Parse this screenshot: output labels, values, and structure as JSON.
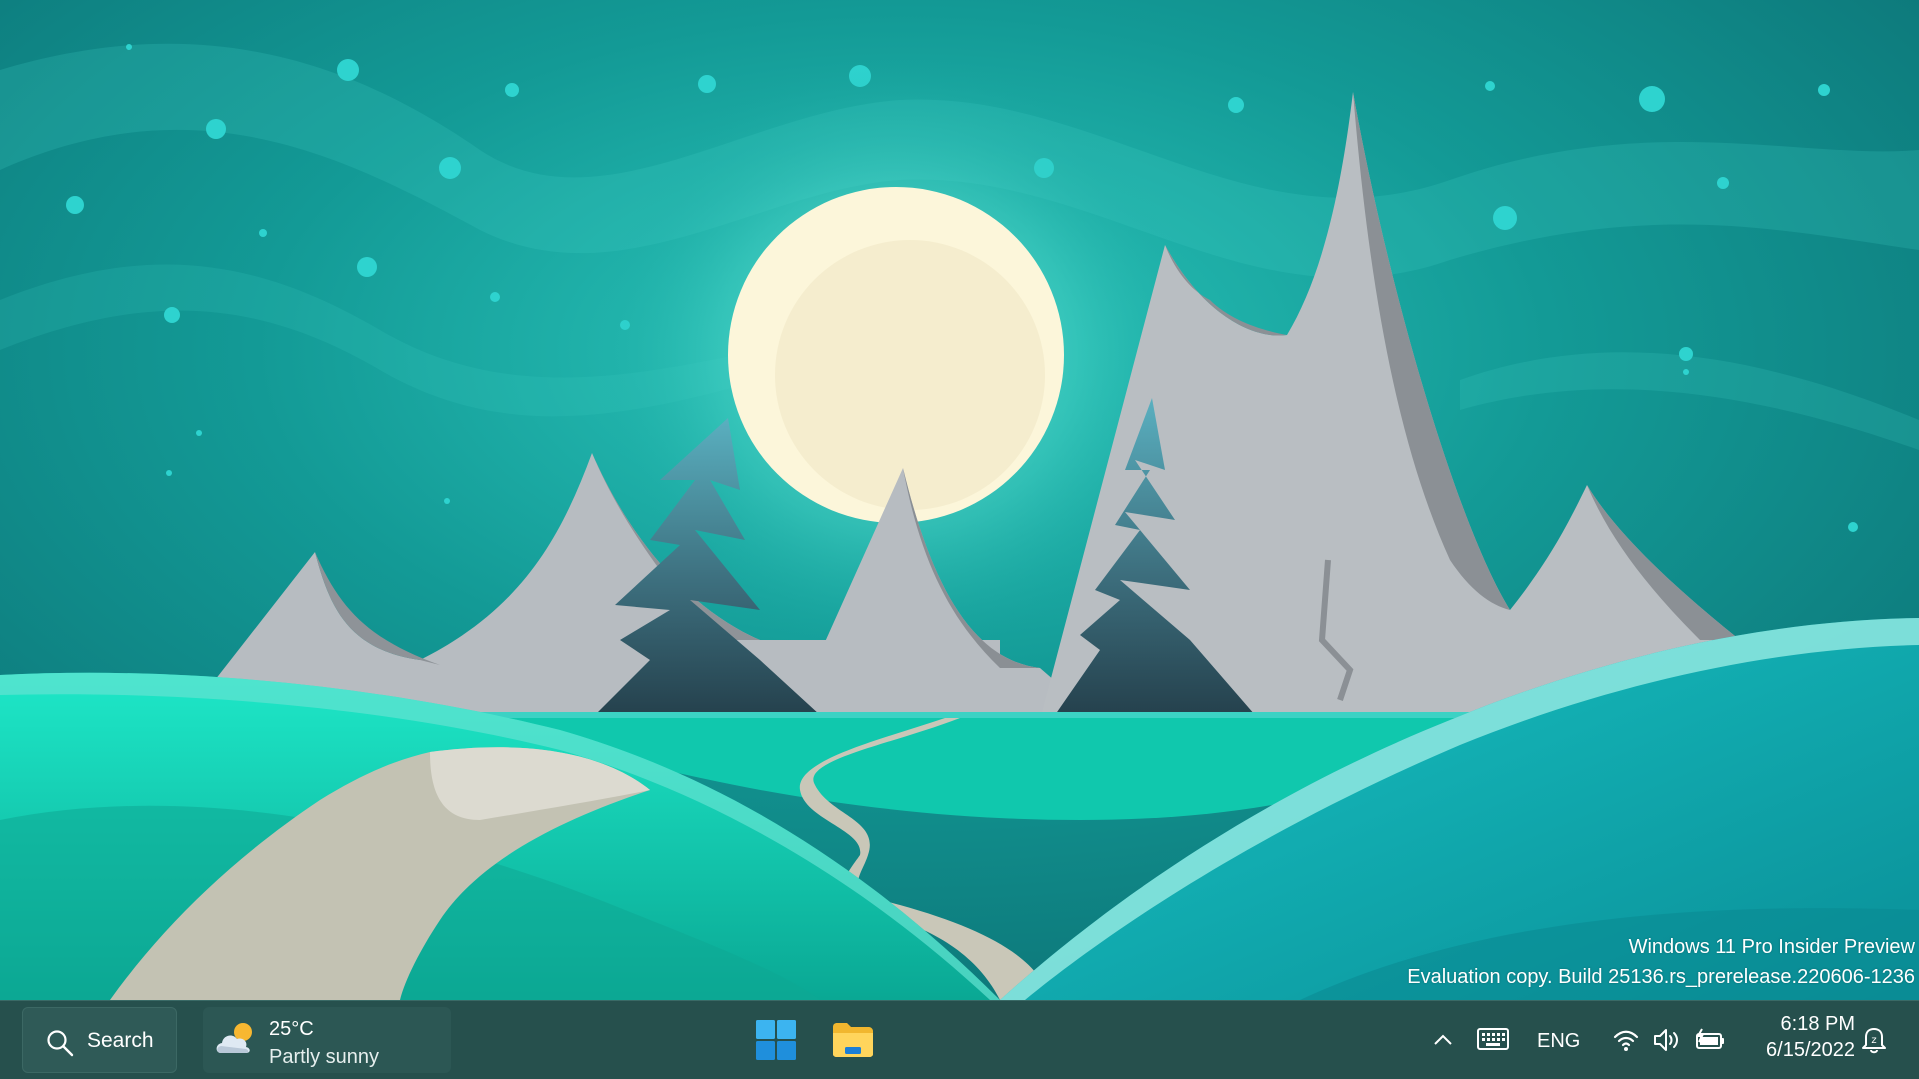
{
  "desktop": {
    "watermark_line1": "Windows 11 Pro Insider Preview",
    "watermark_line2": "Evaluation copy. Build 25136.rs_prerelease.220606-1236"
  },
  "taskbar": {
    "search_label": "Search",
    "weather": {
      "temperature": "25°C",
      "condition": "Partly sunny",
      "icon": "partly-sunny-icon"
    },
    "apps": [
      {
        "name": "Start",
        "icon": "windows-start-icon"
      },
      {
        "name": "File Explorer",
        "icon": "folder-icon"
      }
    ],
    "tray": {
      "icons": [
        "chevron-up-icon",
        "touch-keyboard-icon",
        "wifi-icon",
        "volume-icon",
        "battery-icon",
        "notification-bell-icon"
      ],
      "language": "ENG",
      "time": "6:18 PM",
      "date": "6/15/2022"
    }
  },
  "colors": {
    "taskbar": "#26504d",
    "sky": "#0f7f80",
    "moon": "#fbf6dc",
    "hills": "#12d9be",
    "mountains": "#b9bec2"
  }
}
